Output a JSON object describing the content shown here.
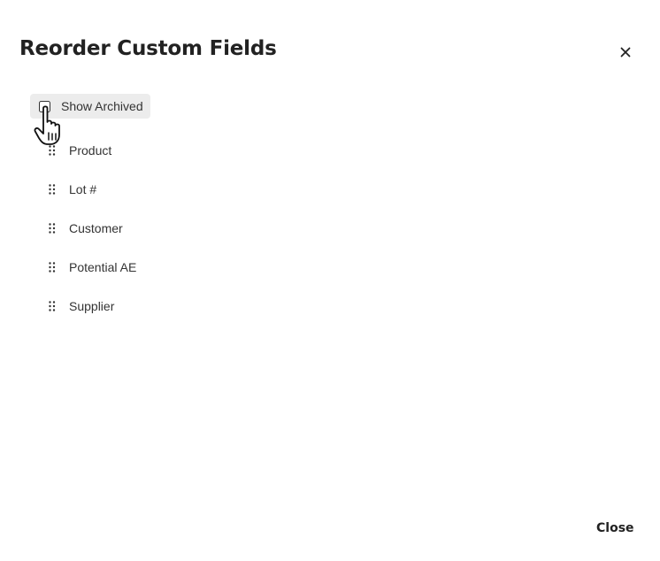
{
  "dialog": {
    "title": "Reorder Custom Fields",
    "close_icon": "close-icon"
  },
  "toggle": {
    "label": "Show Archived",
    "checked": false
  },
  "fields": [
    {
      "label": "Product"
    },
    {
      "label": "Lot #"
    },
    {
      "label": "Customer"
    },
    {
      "label": "Potential AE"
    },
    {
      "label": "Supplier"
    }
  ],
  "icons": {
    "drag_handle": "drag-handle-icon",
    "pointer": "hand-pointer-icon"
  },
  "footer": {
    "close_label": "Close"
  }
}
